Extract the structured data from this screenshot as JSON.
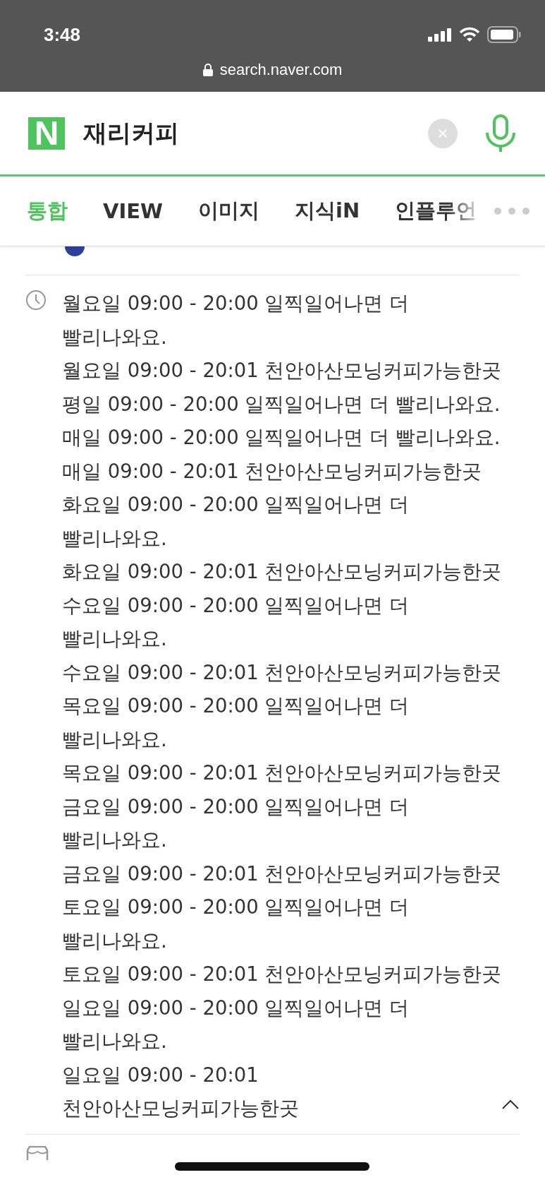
{
  "status_bar": {
    "time": "3:48",
    "url": "search.naver.com"
  },
  "search": {
    "logo": "N",
    "query": "재리커피"
  },
  "tabs": [
    {
      "label": "통합",
      "selected": true
    },
    {
      "label": "VIEW",
      "selected": false
    },
    {
      "label": "이미지",
      "selected": false
    },
    {
      "label": "지식iN",
      "selected": false
    },
    {
      "label": "인플루언",
      "selected": false
    }
  ],
  "hours": {
    "expanded": true,
    "entries": [
      "월요일 09:00 - 20:00 일찍일어나면 더 빨리나와요.",
      "월요일 09:00 - 20:01 천안아산모닝커피가능한곳",
      "평일 09:00 - 20:00 일찍일어나면 더 빨리나와요.",
      "매일 09:00 - 20:00 일찍일어나면 더 빨리나와요.",
      "매일 09:00 - 20:01 천안아산모닝커피가능한곳",
      "화요일 09:00 - 20:00 일찍일어나면 더 빨리나와요.",
      "화요일 09:00 - 20:01 천안아산모닝커피가능한곳",
      "수요일 09:00 - 20:00 일찍일어나면 더 빨리나와요.",
      "수요일 09:00 - 20:01 천안아산모닝커피가능한곳",
      "목요일 09:00 - 20:00 일찍일어나면 더 빨리나와요.",
      "목요일 09:00 - 20:01 천안아산모닝커피가능한곳",
      "금요일 09:00 - 20:00 일찍일어나면 더 빨리나와요.",
      "금요일 09:00 - 20:01 천안아산모닝커피가능한곳",
      "토요일 09:00 - 20:00 일찍일어나면 더 빨리나와요.",
      "토요일 09:00 - 20:01 천안아산모닝커피가능한곳",
      "일요일 09:00 - 20:00 일찍일어나면 더 빨리나와요.",
      "일요일 09:00 - 20:01 천안아산모닝커피가능한곳"
    ]
  }
}
